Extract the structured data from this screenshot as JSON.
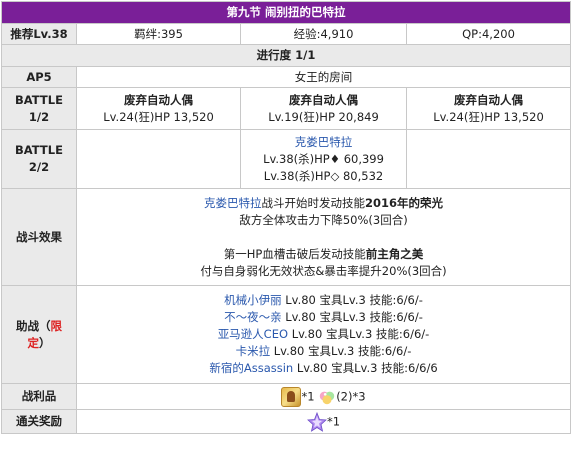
{
  "title": "第九节 闹别扭的巴特拉",
  "info": {
    "recommend": "推荐Lv.38",
    "bond": "羁绊:395",
    "exp": "经验:4,910",
    "qp": "QP:4,200"
  },
  "progress": "进行度 1/1",
  "ap": {
    "label": "AP5",
    "place": "女王的房间"
  },
  "battle1": {
    "label_line1": "BATTLE",
    "label_line2": "1/2",
    "enemies": [
      {
        "name": "废弃自动人偶",
        "stats": "Lv.24(狂)HP 13,520"
      },
      {
        "name": "废弃自动人偶",
        "stats": "Lv.19(狂)HP 20,849"
      },
      {
        "name": "废弃自动人偶",
        "stats": "Lv.24(狂)HP 13,520"
      }
    ]
  },
  "battle2": {
    "label_line1": "BATTLE",
    "label_line2": "2/2",
    "enemy_name": "克娄巴特拉",
    "stats_line1": "Lv.38(杀)HP♦ 60,399",
    "stats_line2": "Lv.38(杀)HP◇ 80,532"
  },
  "effects": {
    "label": "战斗效果",
    "e1_link": "克娄巴特拉",
    "e1_mid": "战斗开始时发动技能",
    "e1_bold": "2016年的荣光",
    "e1_line2": "敌方全体攻击力下降50%(3回合)",
    "e2_pre": "第一HP血槽击破后发动技能",
    "e2_bold": "前主角之美",
    "e2_line2": "付与自身弱化无效状态&暴击率提升20%(3回合)"
  },
  "support": {
    "label_main": "助战（",
    "label_red1": "限",
    "label_red2": "定",
    "label_close": "）",
    "items": [
      {
        "name": "机械小伊丽",
        "detail": " Lv.80 宝具Lv.3 技能:6/6/-"
      },
      {
        "name": "不～夜～亲",
        "detail": " Lv.80 宝具Lv.3 技能:6/6/-"
      },
      {
        "name": "亚马逊人CEO",
        "detail": " Lv.80 宝具Lv.3 技能:6/6/-"
      },
      {
        "name": "卡米拉",
        "detail": " Lv.80 宝具Lv.3 技能:6/6/-"
      },
      {
        "name": "新宿的Assassin",
        "detail": " Lv.80 宝具Lv.3 技能:6/6/6"
      }
    ]
  },
  "drops": {
    "label": "战利品",
    "item1_count": "*1",
    "item2_count": "(2)*3",
    "item1_icon": "gold-coin-icon",
    "item2_icon": "candy-icon"
  },
  "reward": {
    "label": "通关奖励",
    "count": "*1",
    "icon": "saint-quartz-icon"
  }
}
